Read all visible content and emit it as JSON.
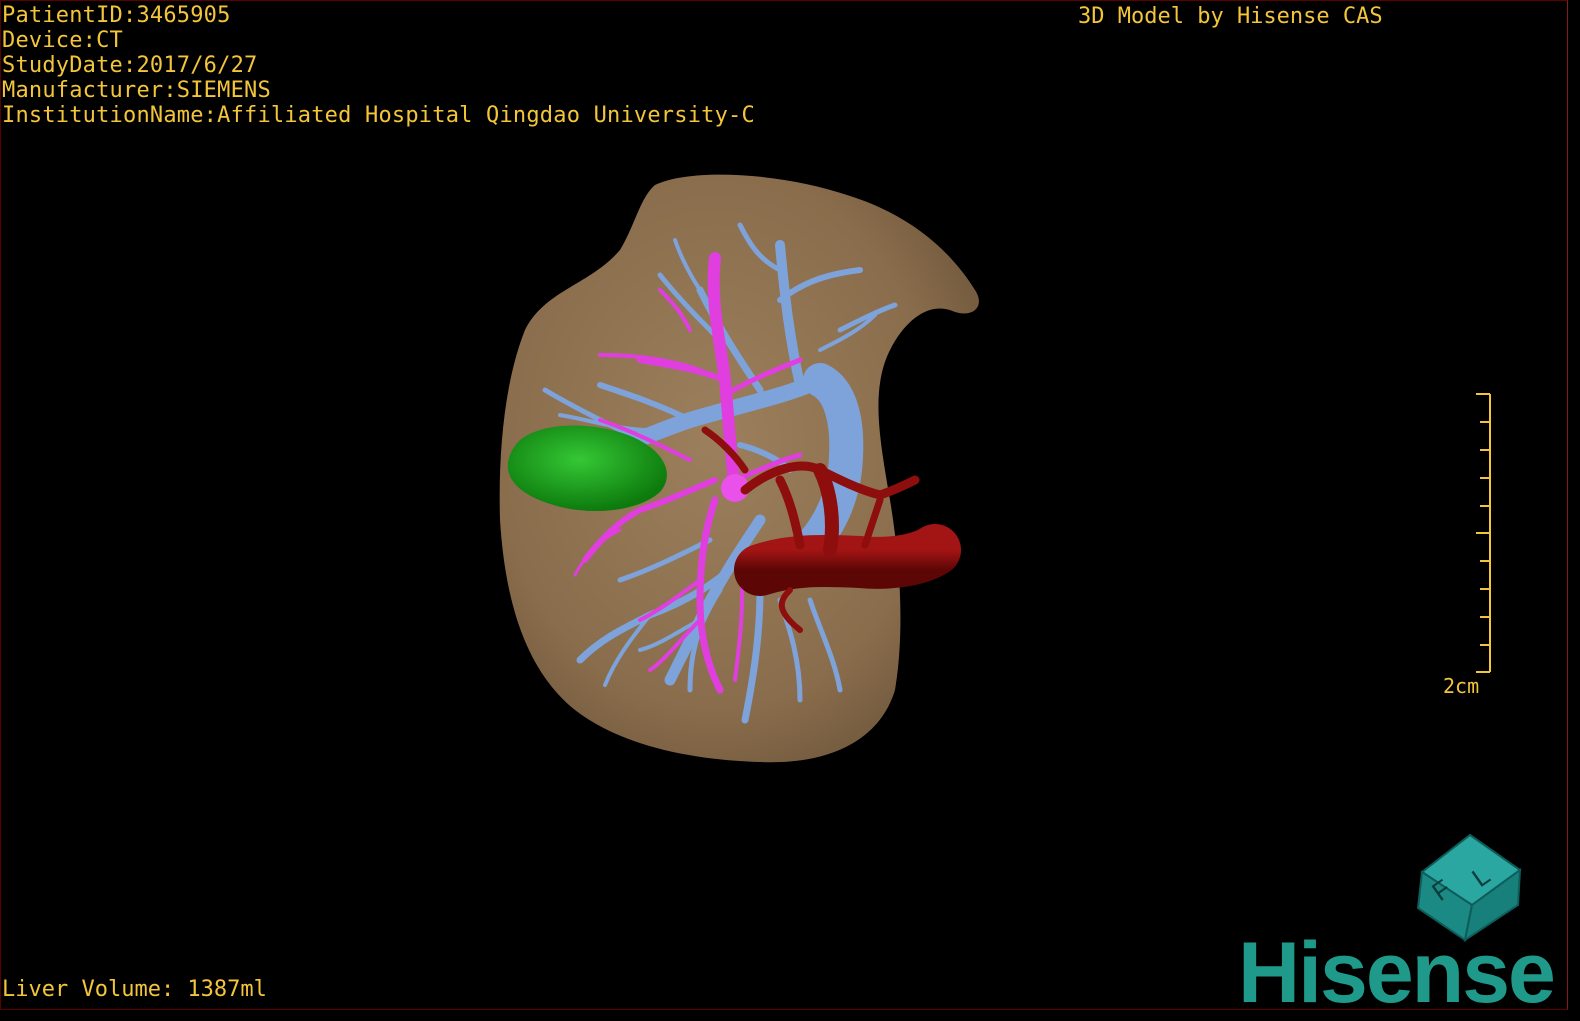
{
  "header": {
    "patient_id": "PatientID:3465905",
    "device": "Device:CT",
    "study_date": "StudyDate:2017/6/27",
    "manufacturer": "Manufacturer:SIEMENS",
    "institution": "InstitutionName:Affiliated Hospital Qingdao University-C",
    "model_credit": "3D Model by Hisense CAS"
  },
  "footer": {
    "liver_volume": "Liver Volume: 1387ml",
    "brand": "Hisense"
  },
  "scale_bar": {
    "label": "2cm"
  },
  "orientation_cube": {
    "face_letters": [
      "F",
      "L"
    ]
  },
  "colors": {
    "text": "#f3c53a",
    "liver": "#8f7352",
    "portal_vein": "#7aa0d8",
    "hepatic_vein": "#e040e0",
    "artery": "#8b0d0d",
    "tumor": "#1a9a1a",
    "brand": "#1f9a8a"
  }
}
